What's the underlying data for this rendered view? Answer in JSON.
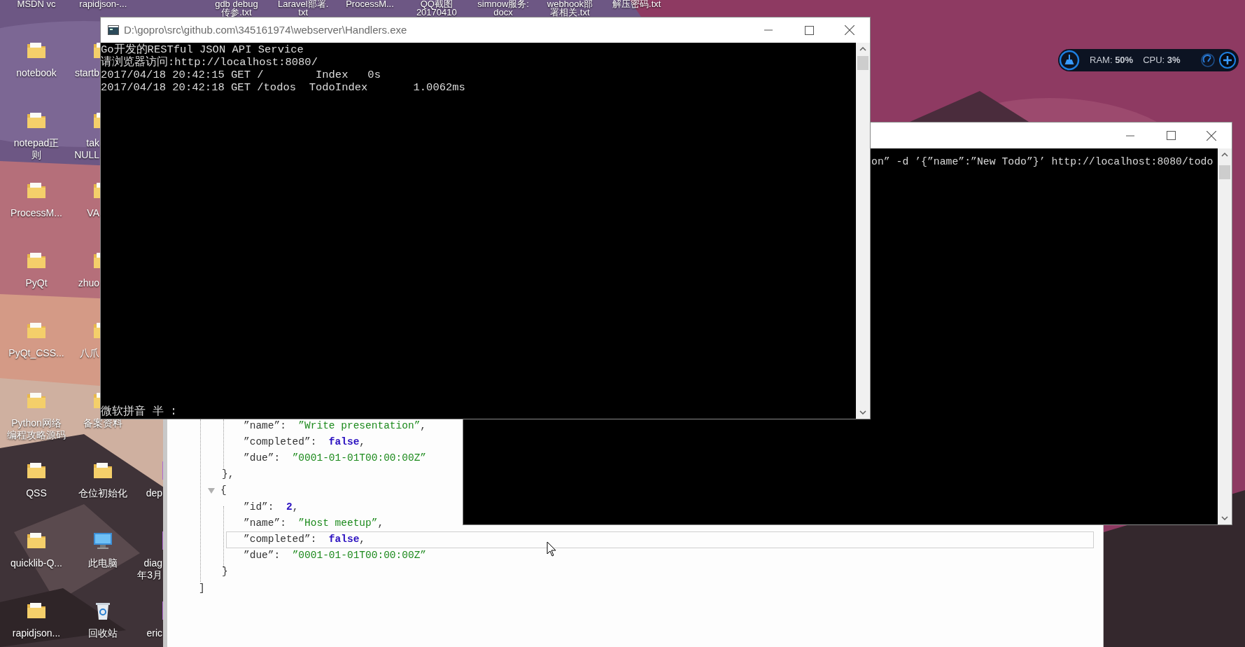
{
  "desktop": {
    "columns": [
      {
        "top_label": [
          "MSDN vc"
        ],
        "icons": [
          {
            "kind": "folder",
            "lines": [
              "notebook"
            ],
            "clipped": false
          },
          {
            "kind": "folder",
            "lines": [
              "notepad正",
              "则"
            ],
            "clipped": false
          },
          {
            "kind": "folder",
            "lines": [
              "ProcessM..."
            ],
            "clipped": false
          },
          {
            "kind": "folder",
            "lines": [
              "PyQt"
            ],
            "clipped": false
          },
          {
            "kind": "folder",
            "lines": [
              "PyQt_CSS..."
            ],
            "clipped": false
          },
          {
            "kind": "folder",
            "lines": [
              "Python网络",
              "编程攻略源码"
            ],
            "clipped": false
          },
          {
            "kind": "folder",
            "lines": [
              "QSS"
            ],
            "clipped": false
          },
          {
            "kind": "folder",
            "lines": [
              "quicklib-Q..."
            ],
            "clipped": false
          },
          {
            "kind": "folder",
            "lines": [
              "rapidjson..."
            ],
            "clipped": false
          }
        ]
      },
      {
        "top_label": [
          "rapidjson-..."
        ],
        "icons": [
          {
            "kind": "folder",
            "lines": [
              "startb"
            ],
            "clipped": true
          },
          {
            "kind": "folder",
            "lines": [
              "tak",
              "NULL"
            ],
            "clipped": true
          },
          {
            "kind": "folder",
            "lines": [
              "VA"
            ],
            "clipped": true
          },
          {
            "kind": "folder",
            "lines": [
              "zhuo"
            ],
            "clipped": true
          },
          {
            "kind": "folder",
            "lines": [
              "八爪"
            ],
            "clipped": true
          },
          {
            "kind": "folder",
            "lines": [
              "备案资料"
            ],
            "clipped": false
          },
          {
            "kind": "folder",
            "lines": [
              "仓位初始化"
            ],
            "clipped": false
          },
          {
            "kind": "computer",
            "lines": [
              "此电脑"
            ],
            "clipped": false
          },
          {
            "kind": "recycle_bin",
            "lines": [
              "回收站"
            ],
            "clipped": false
          }
        ]
      },
      {
        "icons": [
          {
            "kind": "file",
            "lines": [
              "dep"
            ],
            "clipped": true
          },
          {
            "kind": "file",
            "lines": [
              "diag",
              "年3月"
            ],
            "clipped": true
          },
          {
            "kind": "file",
            "lines": [
              "eric"
            ],
            "clipped": true
          }
        ]
      },
      {
        "top_label": [
          "gdb debug",
          "传参.txt"
        ]
      },
      {
        "top_label": [
          "Laravel部署.",
          "txt"
        ]
      },
      {
        "top_label": [
          "ProcessM..."
        ]
      },
      {
        "top_label": [
          "QQ截图",
          "20170410"
        ]
      },
      {
        "top_label": [
          "simnow服务:",
          "docx"
        ]
      },
      {
        "top_label": [
          "webhook部",
          "署相关.txt"
        ]
      },
      {
        "top_label": [
          "解压密码.txt"
        ]
      }
    ]
  },
  "system_monitor": {
    "ram": "RAM: **50%**",
    "cpu": "CPU: **3%**"
  },
  "json_viewer": {
    "lines": [
      {
        "kind": "string_pair",
        "key": "”name”:",
        "value": "”Write presentation”",
        "tail": ",",
        "highlighted": false
      },
      {
        "kind": "boolean_pair",
        "key": "”completed”:",
        "value": "false",
        "tail": ",",
        "highlighted": false
      },
      {
        "kind": "string_pair",
        "key": "”due”:",
        "value": "”0001-01-01T00:00:00Z”",
        "highlighted": false
      },
      {
        "kind": "close_brace",
        "text": "},",
        "highlighted": false
      },
      {
        "kind": "open_brace",
        "text": "{",
        "expanded": true,
        "highlighted": false
      },
      {
        "kind": "number_pair",
        "key": "”id”:",
        "value": "2",
        "tail": ",",
        "highlighted": false
      },
      {
        "kind": "string_pair",
        "key": "”name”:",
        "value": "”Host meetup”",
        "tail": ",",
        "highlighted": false
      },
      {
        "kind": "boolean_pair",
        "key": "”completed”:",
        "value": "false",
        "tail": ",",
        "highlighted": true
      },
      {
        "kind": "string_pair",
        "key": "”due”:",
        "value": "”0001-01-01T00:00:00Z”",
        "highlighted": false
      },
      {
        "kind": "close_brace",
        "text": "}",
        "highlighted": false
      },
      {
        "kind": "close_bracket",
        "text": "]",
        "highlighted": false
      }
    ]
  },
  "terminal_back": {
    "lines": [
      "on” -d ’{”name”:”New Todo”}’ http://localhost:8080/todo"
    ]
  },
  "terminal_front": {
    "title": "D:\\gopro\\src\\github.com\\345161974\\webserver\\Handlers.exe",
    "lines": [
      "Go开发的RESTful JSON API Service",
      "请浏览器访问:http://localhost:8080/",
      "2017/04/18 20:42:15 GET /        Index   0s",
      "2017/04/18 20:42:18 GET /todos  TodoIndex       1.0062ms"
    ],
    "ime_status": "微软拼音 半 :"
  }
}
